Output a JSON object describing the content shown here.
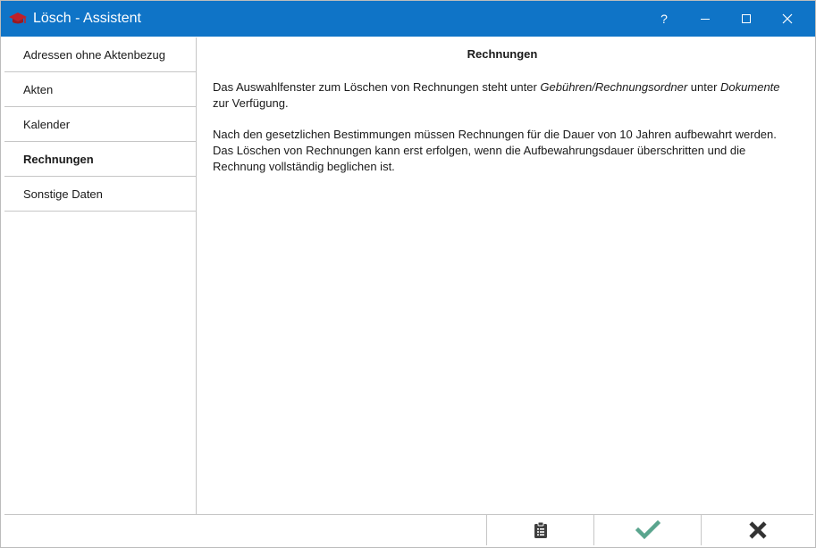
{
  "window": {
    "title": "Lösch - Assistent",
    "help_label": "?",
    "accent_color": "#0f74c7",
    "icon": "graduation-cap-icon"
  },
  "sidebar": {
    "items": [
      {
        "label": "Adressen ohne Aktenbezug",
        "active": false
      },
      {
        "label": "Akten",
        "active": false
      },
      {
        "label": "Kalender",
        "active": false
      },
      {
        "label": "Rechnungen",
        "active": true
      },
      {
        "label": "Sonstige Daten",
        "active": false
      }
    ]
  },
  "content": {
    "title": "Rechnungen",
    "para1": {
      "t1": "Das Auswahlfenster zum Löschen von Rechnungen steht unter ",
      "em1": "Gebühren/Rechnungsordner",
      "t2": " unter ",
      "em2": "Dokumente",
      "t3": " zur Verfügung."
    },
    "para2": "Nach den gesetzlichen Bestimmungen müssen Rechnungen für die Dauer von 10 Jahren aufbewahrt werden. Das Löschen von Rechnungen kann erst erfolgen, wenn die Aufbewahrungsdauer überschritten und die Rechnung vollständig beglichen ist."
  },
  "bottombar": {
    "buttons": [
      {
        "icon": "clipboard-icon"
      },
      {
        "icon": "checkmark-icon",
        "color": "#5aa58e"
      },
      {
        "icon": "cross-icon",
        "color": "#333333"
      }
    ]
  }
}
